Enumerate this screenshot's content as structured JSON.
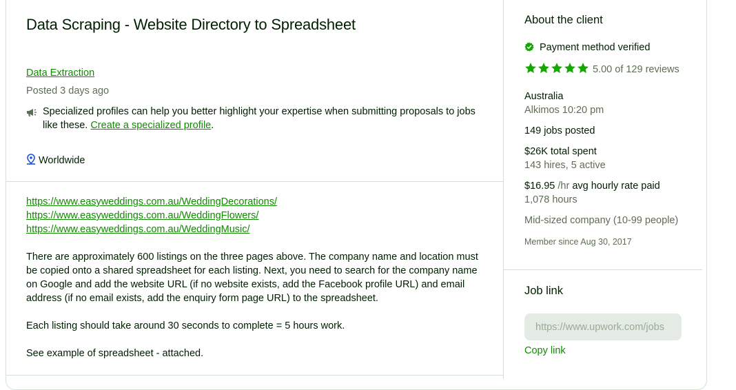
{
  "job": {
    "title": "Data Scraping - Website Directory to Spreadsheet",
    "category": "Data Extraction",
    "posted": "Posted 3 days ago",
    "promo_text": "Specialized profiles can help you better highlight your expertise when submitting proposals to jobs like these.",
    "promo_link": "Create a specialized profile",
    "promo_end": ".",
    "location": "Worldwide"
  },
  "description": {
    "links": [
      "https://www.easyweddings.com.au/WeddingDecorations/",
      "https://www.easyweddings.com.au/WeddingFlowers/",
      "https://www.easyweddings.com.au/WeddingMusic/"
    ],
    "paragraphs": [
      "There are approximately 600 listings on the three pages above. The company name and location must be copied onto a shared spreadsheet for each listing. Next, you need to search for the company name on Google and add the website URL (if no website exists, add the Facebook profile URL) and email address (if no email exists, add the enquiry form page URL) to the spreadsheet.",
      "Each listing should take around 30 seconds to complete = 5 hours work.",
      "See example of spreadsheet - attached."
    ]
  },
  "client": {
    "heading": "About the client",
    "payment": "Payment method verified",
    "rating": 5.0,
    "rating_text": "5.00 of 129 reviews",
    "country": "Australia",
    "local_time": "Alkimos 10:20 pm",
    "jobs_posted": "149 jobs posted",
    "total_spent": "$26K total spent",
    "hires": "143 hires, 5 active",
    "rate_value": "$16.95",
    "rate_unit": " /hr",
    "rate_label": " avg hourly rate paid",
    "hours": "1,078 hours",
    "company_size": "Mid-sized company (10-99 people)",
    "member_since": "Member since Aug 30, 2017"
  },
  "job_link": {
    "heading": "Job link",
    "value": "https://www.upwork.com/jobs",
    "copy_label": "Copy link"
  },
  "colors": {
    "accent": "#108a00",
    "text": "#001e00",
    "muted": "#5e6d55",
    "border": "#d5e0d5"
  }
}
